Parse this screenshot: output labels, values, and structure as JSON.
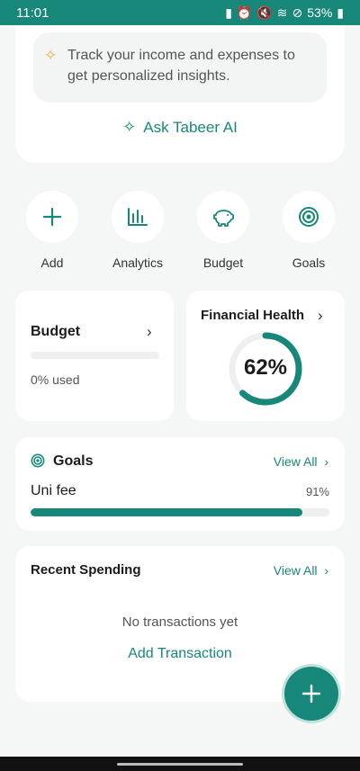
{
  "status": {
    "time": "11:01",
    "battery": "53%"
  },
  "insight": {
    "text": "Track your income and expenses to get personalized insights.",
    "ask_ai_label": "Ask Tabeer AI"
  },
  "quick_actions": [
    {
      "label": "Add",
      "icon": "plus-icon"
    },
    {
      "label": "Analytics",
      "icon": "bar-chart-icon"
    },
    {
      "label": "Budget",
      "icon": "piggy-bank-icon"
    },
    {
      "label": "Goals",
      "icon": "target-icon"
    }
  ],
  "budget": {
    "title": "Budget",
    "used_text": "0% used",
    "used_fraction": 0
  },
  "financial_health": {
    "title": "Financial Health",
    "score_text": "62%",
    "score": 62
  },
  "goals": {
    "title": "Goals",
    "view_all": "View All",
    "items": [
      {
        "name": "Uni fee",
        "percent_text": "91%",
        "percent": 91
      }
    ]
  },
  "recent_spending": {
    "title": "Recent Spending",
    "view_all": "View All",
    "empty_text": "No transactions yet",
    "add_label": "Add Transaction"
  },
  "colors": {
    "accent": "#17877a",
    "background": "#f5f6f6",
    "sparkle": "#e8b53a"
  }
}
